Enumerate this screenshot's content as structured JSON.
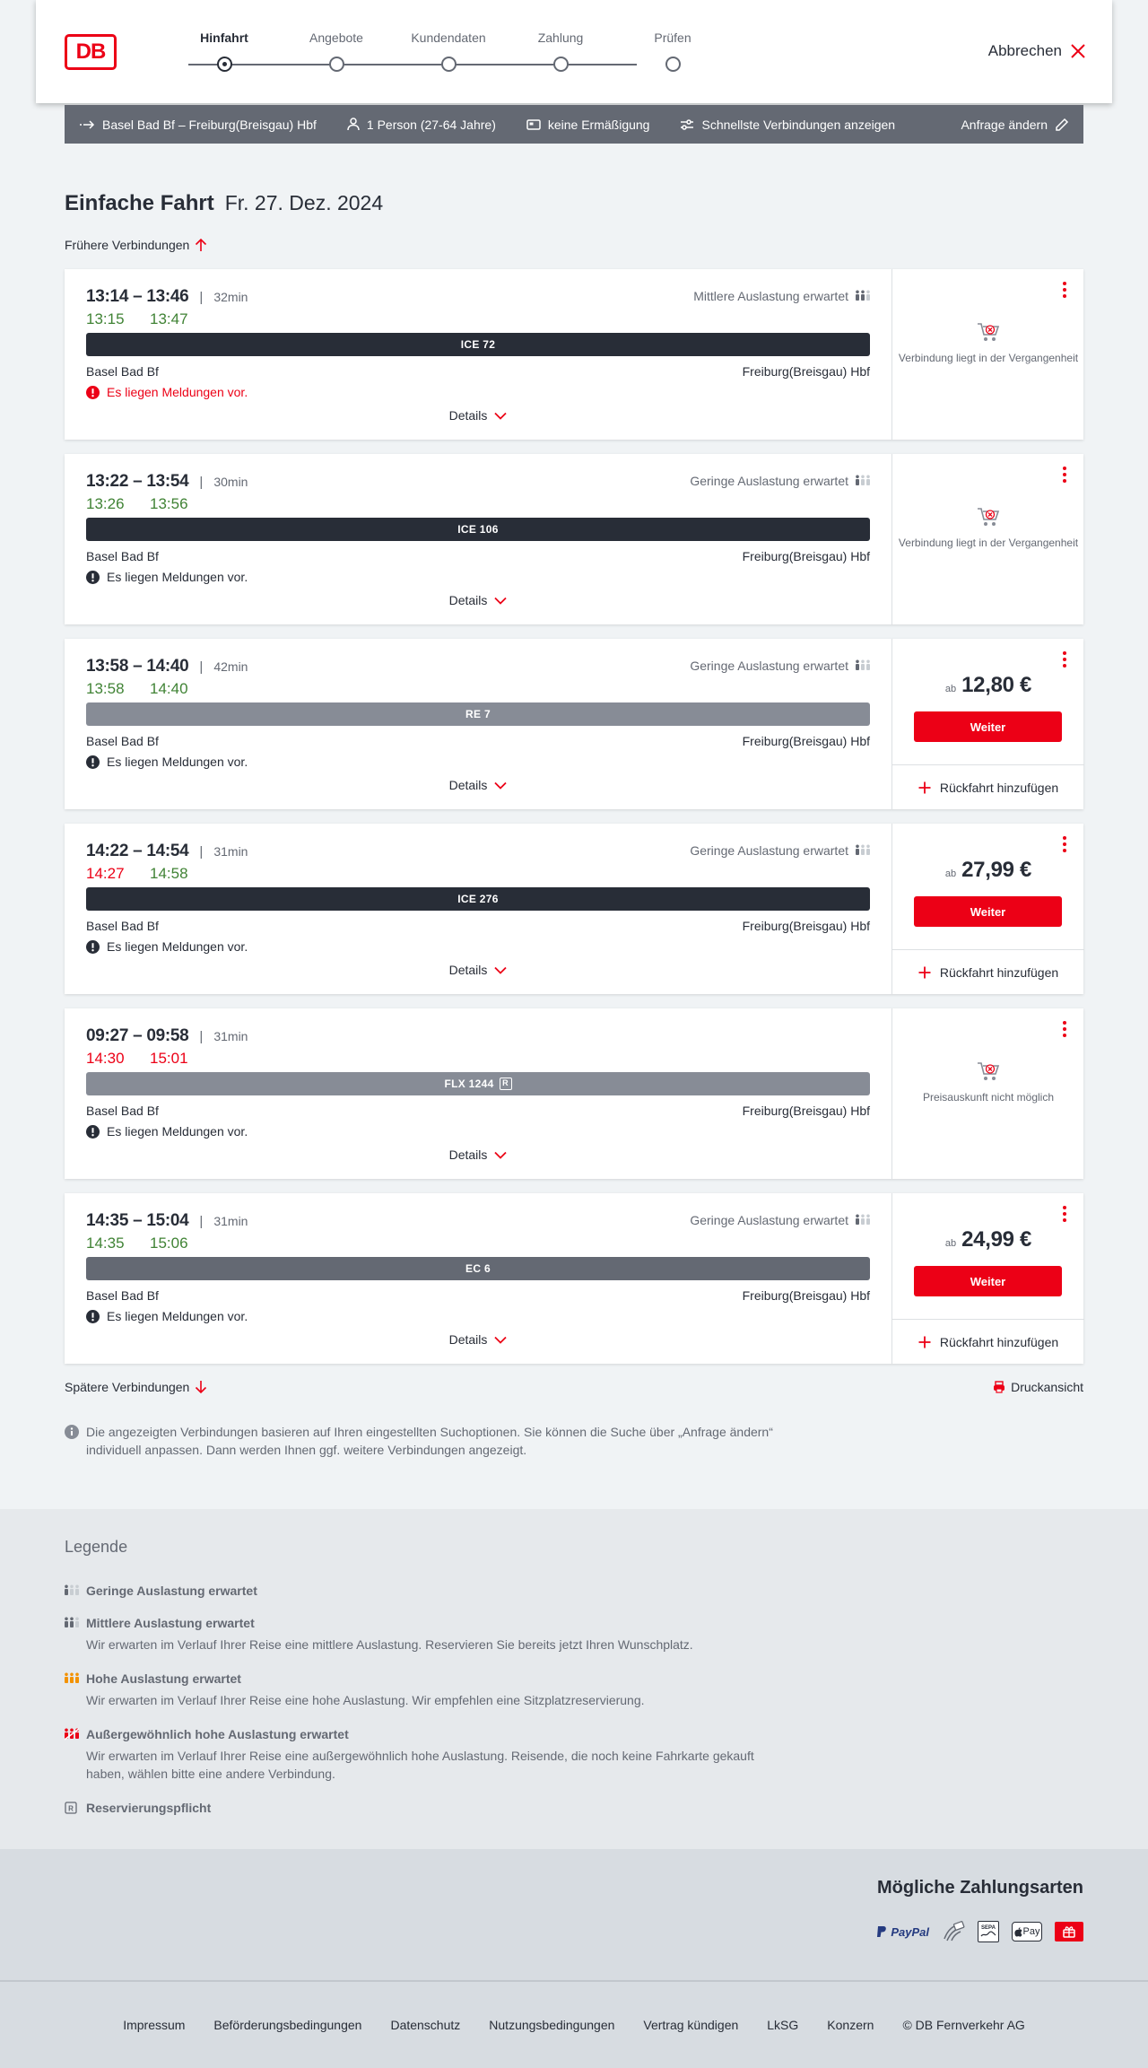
{
  "header": {
    "logo": "DB",
    "steps": [
      "Hinfahrt",
      "Angebote",
      "Kundendaten",
      "Zahlung",
      "Prüfen"
    ],
    "cancel_label": "Abbrechen"
  },
  "search": {
    "route": "Basel Bad Bf – Freiburg(Breisgau) Hbf",
    "persons": "1 Person (27-64 Jahre)",
    "discount": "keine Ermäßigung",
    "fastest": "Schnellste Verbindungen anzeigen",
    "change": "Anfrage ändern"
  },
  "title": {
    "main": "Einfache Fahrt",
    "date": "Fr. 27. Dez. 2024"
  },
  "earlier_label": "Frühere Verbindungen",
  "later_label": "Spätere Verbindungen",
  "print_label": "Druckansicht",
  "details_label": "Details",
  "weiter_label": "Weiter",
  "return_label": "Rückfahrt hinzufügen",
  "ab_label": "ab",
  "connections": [
    {
      "times": "13:14 – 13:46",
      "duration": "32min",
      "rt_dep": "13:15",
      "rt_arr": "13:47",
      "rt_dep_status": "ok",
      "rt_arr_status": "ok",
      "load": "Mittlere Auslastung erwartet",
      "load_level": 2,
      "train": "ICE 72",
      "train_color": "#282d37",
      "reservation": false,
      "from": "Basel Bad Bf",
      "to": "Freiburg(Breisgau) Hbf",
      "message": "Es liegen Meldungen vor.",
      "message_red": true,
      "state": "past",
      "state_text": "Verbindung liegt in der Vergangenheit"
    },
    {
      "times": "13:22 – 13:54",
      "duration": "30min",
      "rt_dep": "13:26",
      "rt_arr": "13:56",
      "rt_dep_status": "ok",
      "rt_arr_status": "ok",
      "load": "Geringe Auslastung erwartet",
      "load_level": 1,
      "train": "ICE 106",
      "train_color": "#282d37",
      "reservation": false,
      "from": "Basel Bad Bf",
      "to": "Freiburg(Breisgau) Hbf",
      "message": "Es liegen Meldungen vor.",
      "message_red": false,
      "state": "past",
      "state_text": "Verbindung liegt in der Vergangenheit"
    },
    {
      "times": "13:58 – 14:40",
      "duration": "42min",
      "rt_dep": "13:58",
      "rt_arr": "14:40",
      "rt_dep_status": "ok",
      "rt_arr_status": "ok",
      "load": "Geringe Auslastung erwartet",
      "load_level": 1,
      "train": "RE 7",
      "train_color": "#878c96",
      "reservation": false,
      "from": "Basel Bad Bf",
      "to": "Freiburg(Breisgau) Hbf",
      "message": "Es liegen Meldungen vor.",
      "message_red": false,
      "state": "price",
      "price": "12,80 €"
    },
    {
      "times": "14:22 – 14:54",
      "duration": "31min",
      "rt_dep": "14:27",
      "rt_arr": "14:58",
      "rt_dep_status": "late",
      "rt_arr_status": "ok",
      "load": "Geringe Auslastung erwartet",
      "load_level": 1,
      "train": "ICE 276",
      "train_color": "#282d37",
      "reservation": false,
      "from": "Basel Bad Bf",
      "to": "Freiburg(Breisgau) Hbf",
      "message": "Es liegen Meldungen vor.",
      "message_red": false,
      "state": "price",
      "price": "27,99 €"
    },
    {
      "times": "09:27 – 09:58",
      "duration": "31min",
      "rt_dep": "14:30",
      "rt_arr": "15:01",
      "rt_dep_status": "late",
      "rt_arr_status": "late",
      "load": "",
      "load_level": 0,
      "train": "FLX 1244",
      "train_color": "#878c96",
      "reservation": true,
      "from": "Basel Bad Bf",
      "to": "Freiburg(Breisgau) Hbf",
      "message": "Es liegen Meldungen vor.",
      "message_red": false,
      "state": "noprice",
      "state_text": "Preisauskunft nicht möglich"
    },
    {
      "times": "14:35 – 15:04",
      "duration": "31min",
      "rt_dep": "14:35",
      "rt_arr": "15:06",
      "rt_dep_status": "ok",
      "rt_arr_status": "ok",
      "load": "Geringe Auslastung erwartet",
      "load_level": 1,
      "train": "EC 6",
      "train_color": "#646973",
      "reservation": false,
      "from": "Basel Bad Bf",
      "to": "Freiburg(Breisgau) Hbf",
      "message": "Es liegen Meldungen vor.",
      "message_red": false,
      "state": "price",
      "price": "24,99 €"
    }
  ],
  "info_text": "Die angezeigten Verbindungen basieren auf Ihren eingestellten Suchoptionen. Sie können die Suche über „Anfrage ändern“ individuell anpassen. Dann werden Ihnen ggf. weitere Verbindungen angezeigt.",
  "legend": {
    "title": "Legende",
    "items": [
      {
        "icon": "load-low-icon",
        "color": "#646973",
        "level": 1,
        "title": "Geringe Auslastung erwartet",
        "desc": ""
      },
      {
        "icon": "load-medium-icon",
        "color": "#646973",
        "level": 2,
        "title": "Mittlere Auslastung erwartet",
        "desc": "Wir erwarten im Verlauf Ihrer Reise eine mittlere Auslastung. Reservieren Sie bereits jetzt Ihren Wunschplatz."
      },
      {
        "icon": "load-high-icon",
        "color": "#f39200",
        "level": 3,
        "title": "Hohe Auslastung erwartet",
        "desc": "Wir erwarten im Verlauf Ihrer Reise eine hohe Auslastung. Wir empfehlen eine Sitzplatzreservierung."
      },
      {
        "icon": "load-extreme-icon",
        "color": "#ec0016",
        "level": 4,
        "title": "Außergewöhnlich hohe Auslastung erwartet",
        "desc": "Wir erwarten im Verlauf Ihrer Reise eine außergewöhnlich hohe Auslastung. Reisende, die noch keine Fahrkarte gekauft haben, wählen bitte eine andere Verbindung."
      },
      {
        "icon": "reservation-required-icon",
        "color": "#646973",
        "level": 0,
        "title": "Reservierungspflicht",
        "desc": ""
      }
    ]
  },
  "payment": {
    "title": "Mögliche Zahlungsarten",
    "icons": [
      "paypal-icon",
      "creditcard-icon",
      "sepa-icon",
      "apple-pay-icon",
      "db-bonus-icon"
    ],
    "paypal_text": "PayPal",
    "apple_text": "Pay",
    "sepa_text": "SEPA"
  },
  "footer": {
    "links": [
      "Impressum",
      "Beförderungsbedingungen",
      "Datenschutz",
      "Nutzungsbedingungen",
      "Vertrag kündigen",
      "LkSG",
      "Konzern"
    ],
    "copyright": "© DB Fernverkehr AG"
  }
}
